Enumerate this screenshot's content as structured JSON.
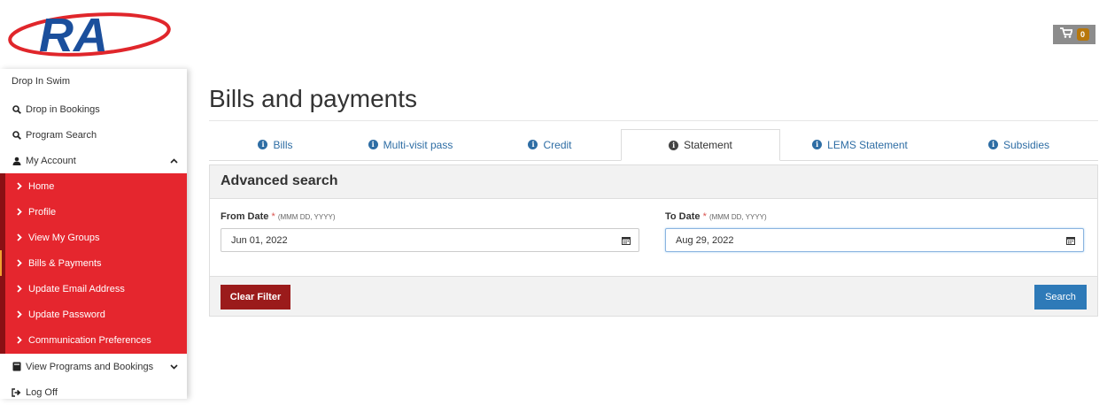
{
  "header": {
    "logo_text": "RA",
    "cart_count": "0",
    "colors": {
      "logo_blue": "#1b4f9c",
      "logo_red": "#e0262b",
      "cart_bg": "#8c8c8c",
      "badge": "#b7770b"
    }
  },
  "sidebar": {
    "top_label": "Drop In Swim",
    "links": [
      {
        "label": "Drop in Bookings",
        "icon": "search-icon"
      },
      {
        "label": "Program Search",
        "icon": "search-icon"
      }
    ],
    "account": {
      "label": "My Account",
      "icon": "user-icon",
      "toggle_icon": "chevron-up-icon"
    },
    "account_items": [
      {
        "label": "Home"
      },
      {
        "label": "Profile"
      },
      {
        "label": "View My Groups"
      },
      {
        "label": "Bills & Payments",
        "active": true
      },
      {
        "label": "Update Email Address"
      },
      {
        "label": "Update Password"
      },
      {
        "label": "Communication Preferences"
      }
    ],
    "programs": {
      "label": "View Programs and Bookings",
      "icon": "book-icon",
      "toggle_icon": "chevron-down-icon"
    },
    "logoff": {
      "label": "Log Off",
      "icon": "sign-out-icon"
    },
    "colors": {
      "accent_red": "#e5262e",
      "accent_dark": "#8a1014"
    }
  },
  "main": {
    "title": "Bills and payments",
    "tabs": [
      {
        "label": "Bills",
        "icon": "info-icon"
      },
      {
        "label": "Multi-visit pass",
        "icon": "info-icon"
      },
      {
        "label": "Credit",
        "icon": "info-icon"
      },
      {
        "label": "Statement",
        "icon": "info-icon",
        "active": true
      },
      {
        "label": "LEMS Statement",
        "icon": "info-icon"
      },
      {
        "label": "Subsidies",
        "icon": "info-icon"
      }
    ],
    "advanced_search": {
      "title": "Advanced search",
      "from": {
        "label": "From Date",
        "required": "*",
        "hint": "(MMM DD, YYYY)",
        "value": "Jun 01, 2022"
      },
      "to": {
        "label": "To Date",
        "required": "*",
        "hint": "(MMM DD, YYYY)",
        "value": "Aug 29, 2022"
      },
      "clear_label": "Clear Filter",
      "search_label": "Search"
    }
  }
}
